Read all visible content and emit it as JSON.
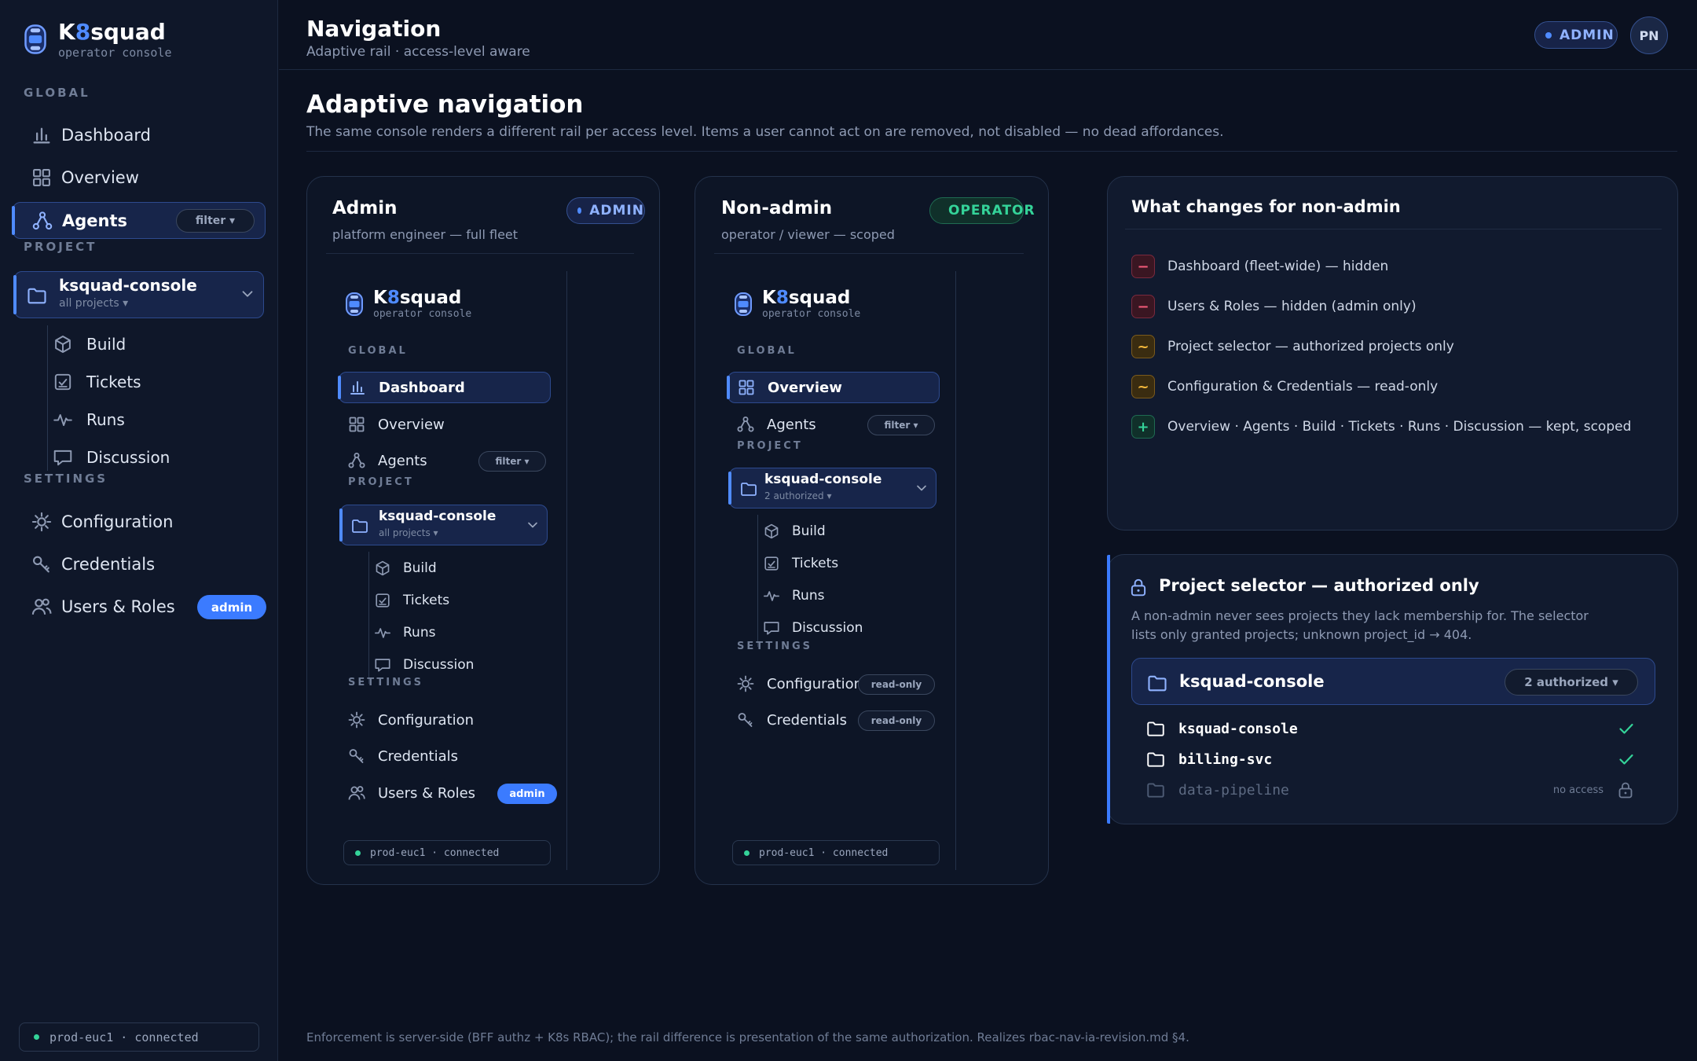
{
  "brand": {
    "name_prefix": "K",
    "name_accent": "8",
    "name_suffix": "squad",
    "subtitle": "operator console"
  },
  "sidebar": {
    "global_label": "GLOBAL",
    "project_label": "PROJECT",
    "settings_label": "SETTINGS",
    "items": {
      "dashboard": "Dashboard",
      "overview": "Overview",
      "agents": "Agents",
      "agents_filter": "filter ▾",
      "configuration": "Configuration",
      "credentials": "Credentials",
      "users_roles": "Users & Roles",
      "users_badge": "admin"
    },
    "project": {
      "name": "ksquad-console",
      "sub": "all projects ▾"
    },
    "project_items": {
      "build": "Build",
      "tickets": "Tickets",
      "runs": "Runs",
      "discussion": "Discussion"
    },
    "connection": "prod-euc1 · connected"
  },
  "header": {
    "title": "Navigation",
    "subtitle": "Adaptive rail · access-level aware",
    "role_badge": "ADMIN",
    "avatar_initials": "PN"
  },
  "main": {
    "title": "Adaptive navigation",
    "description": "The same console renders a different rail per access level. Items a user cannot act on are removed, not disabled — no dead affordances."
  },
  "admin_card": {
    "title": "Admin",
    "subtitle": "platform engineer — full fleet",
    "badge": "ADMIN",
    "rail": {
      "global_label": "GLOBAL",
      "project_label": "PROJECT",
      "settings_label": "SETTINGS",
      "dashboard": "Dashboard",
      "overview": "Overview",
      "agents": "Agents",
      "agents_filter": "filter ▾",
      "project_name": "ksquad-console",
      "project_sub": "all projects ▾",
      "build": "Build",
      "tickets": "Tickets",
      "runs": "Runs",
      "discussion": "Discussion",
      "configuration": "Configuration",
      "credentials": "Credentials",
      "users_roles": "Users & Roles",
      "users_badge": "admin",
      "connection": "prod-euc1 · connected"
    }
  },
  "nonadmin_card": {
    "title": "Non-admin",
    "subtitle": "operator / viewer — scoped",
    "badge": "OPERATOR",
    "rail": {
      "global_label": "GLOBAL",
      "project_label": "PROJECT",
      "settings_label": "SETTINGS",
      "overview": "Overview",
      "agents": "Agents",
      "agents_filter": "filter ▾",
      "project_name": "ksquad-console",
      "project_sub": "2 authorized ▾",
      "build": "Build",
      "tickets": "Tickets",
      "runs": "Runs",
      "discussion": "Discussion",
      "configuration": "Configuration",
      "credentials": "Credentials",
      "readonly": "read-only",
      "connection": "prod-euc1 · connected"
    }
  },
  "changes": {
    "title": "What changes for non-admin",
    "items": [
      {
        "mark": "−",
        "kind": "removed",
        "text": "Dashboard (fleet-wide) — hidden"
      },
      {
        "mark": "−",
        "kind": "removed",
        "text": "Users & Roles — hidden (admin only)"
      },
      {
        "mark": "~",
        "kind": "changed",
        "text": "Project selector — authorized projects only"
      },
      {
        "mark": "~",
        "kind": "changed",
        "text": "Configuration & Credentials — read-only"
      },
      {
        "mark": "+",
        "kind": "kept",
        "text": "Overview · Agents · Build · Tickets · Runs · Discussion — kept, scoped"
      }
    ]
  },
  "selector": {
    "title": "Project selector — authorized only",
    "description": "A non-admin never sees projects they lack membership for. The selector lists only granted projects; unknown project_id → 404.",
    "current": "ksquad-console",
    "count": "2 authorized ▾",
    "options": [
      {
        "name": "ksquad-console",
        "state": "authorized"
      },
      {
        "name": "billing-svc",
        "state": "authorized"
      },
      {
        "name": "data-pipeline",
        "state": "no access",
        "label": "no access"
      }
    ]
  },
  "footer": "Enforcement is server-side (BFF authz + K8s RBAC); the rail difference is presentation of the same authorization. Realizes rbac-nav-ia-revision.md §4.",
  "colors": {
    "background": "#0b1120",
    "accent": "#4f8bff",
    "operator": "#34d399",
    "removed": "#f05a78",
    "changed": "#f5b83b"
  }
}
